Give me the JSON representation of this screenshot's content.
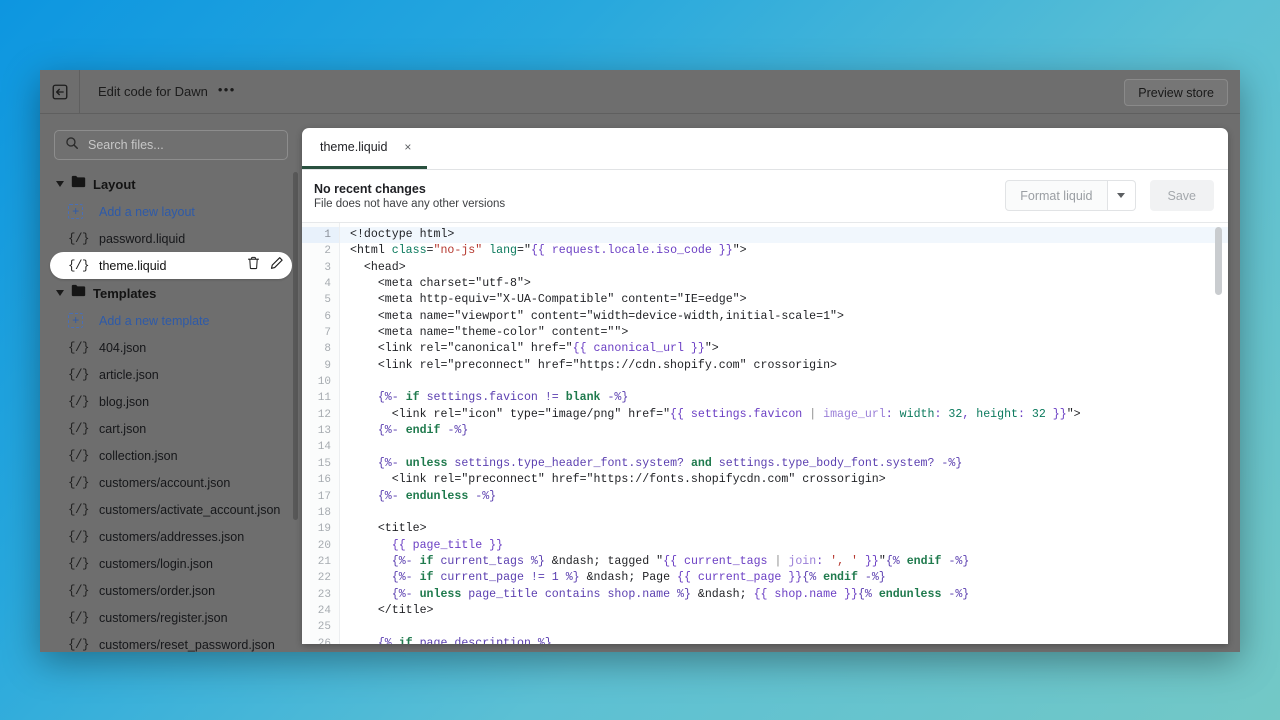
{
  "window": {
    "topbar": {
      "back_icon": "back-arrow-icon",
      "title": "Edit code for Dawn",
      "more_label": "•••",
      "preview_store_label": "Preview store"
    }
  },
  "sidebar": {
    "search": {
      "placeholder": "Search files...",
      "value": "",
      "icon": "search-icon"
    },
    "groups": [
      {
        "label": "Layout",
        "icon": "folder-icon",
        "items": [
          {
            "label": "Add a new layout",
            "icon": "add-file-icon",
            "kind": "add"
          },
          {
            "label": "password.liquid",
            "icon": "liquid-file-icon",
            "kind": "file"
          },
          {
            "label": "theme.liquid",
            "icon": "liquid-file-icon",
            "kind": "file",
            "selected": true,
            "actions": [
              "delete-icon",
              "rename-icon"
            ]
          }
        ]
      },
      {
        "label": "Templates",
        "icon": "folder-icon",
        "items": [
          {
            "label": "Add a new template",
            "icon": "add-file-icon",
            "kind": "add"
          },
          {
            "label": "404.json",
            "icon": "liquid-file-icon",
            "kind": "file"
          },
          {
            "label": "article.json",
            "icon": "liquid-file-icon",
            "kind": "file"
          },
          {
            "label": "blog.json",
            "icon": "liquid-file-icon",
            "kind": "file"
          },
          {
            "label": "cart.json",
            "icon": "liquid-file-icon",
            "kind": "file"
          },
          {
            "label": "collection.json",
            "icon": "liquid-file-icon",
            "kind": "file"
          },
          {
            "label": "customers/account.json",
            "icon": "liquid-file-icon",
            "kind": "file"
          },
          {
            "label": "customers/activate_account.json",
            "icon": "liquid-file-icon",
            "kind": "file"
          },
          {
            "label": "customers/addresses.json",
            "icon": "liquid-file-icon",
            "kind": "file"
          },
          {
            "label": "customers/login.json",
            "icon": "liquid-file-icon",
            "kind": "file"
          },
          {
            "label": "customers/order.json",
            "icon": "liquid-file-icon",
            "kind": "file"
          },
          {
            "label": "customers/register.json",
            "icon": "liquid-file-icon",
            "kind": "file"
          },
          {
            "label": "customers/reset_password.json",
            "icon": "liquid-file-icon",
            "kind": "file"
          }
        ]
      }
    ]
  },
  "editor": {
    "tabs": [
      {
        "label": "theme.liquid",
        "active": true,
        "close_label": "×"
      }
    ],
    "status": {
      "title": "No recent changes",
      "subtitle": "File does not have any other versions"
    },
    "actions": {
      "format_label": "Format liquid",
      "format_caret_icon": "chevron-down-icon",
      "save_label": "Save",
      "save_disabled": true
    },
    "filename": "theme.liquid",
    "first_visible_line": 1,
    "last_visible_line": 26,
    "highlighted_line": 1,
    "lines": [
      {
        "n": 1,
        "tokens": [
          [
            "plain",
            "<!doctype html>"
          ]
        ]
      },
      {
        "n": 2,
        "tokens": [
          [
            "plain",
            "<html "
          ],
          [
            "attr",
            "class"
          ],
          [
            "plain",
            "="
          ],
          [
            "str",
            "\"no-js\""
          ],
          [
            "plain",
            " "
          ],
          [
            "attr",
            "lang"
          ],
          [
            "plain",
            "=\""
          ],
          [
            "obj",
            "{{ request.locale.iso_code }}"
          ],
          [
            "plain",
            "\">"
          ]
        ]
      },
      {
        "n": 3,
        "tokens": [
          [
            "plain",
            "  <head>"
          ]
        ]
      },
      {
        "n": 4,
        "tokens": [
          [
            "plain",
            "    <meta charset=\"utf-8\">"
          ]
        ]
      },
      {
        "n": 5,
        "tokens": [
          [
            "plain",
            "    <meta http-equiv=\"X-UA-Compatible\" content=\"IE=edge\">"
          ]
        ]
      },
      {
        "n": 6,
        "tokens": [
          [
            "plain",
            "    <meta name=\"viewport\" content=\"width=device-width,initial-scale=1\">"
          ]
        ]
      },
      {
        "n": 7,
        "tokens": [
          [
            "plain",
            "    <meta name=\"theme-color\" content=\"\">"
          ]
        ]
      },
      {
        "n": 8,
        "tokens": [
          [
            "plain",
            "    <link rel=\"canonical\" href=\""
          ],
          [
            "obj",
            "{{ canonical_url }}"
          ],
          [
            "plain",
            "\">"
          ]
        ]
      },
      {
        "n": 9,
        "tokens": [
          [
            "plain",
            "    <link rel=\"preconnect\" href=\"https://cdn.shopify.com\" crossorigin>"
          ]
        ]
      },
      {
        "n": 10,
        "tokens": [
          [
            "plain",
            ""
          ]
        ]
      },
      {
        "n": 11,
        "tokens": [
          [
            "plain",
            "    "
          ],
          [
            "liq",
            "{%- "
          ],
          [
            "kw",
            "if"
          ],
          [
            "liq",
            " settings.favicon != "
          ],
          [
            "kw",
            "blank"
          ],
          [
            "liq",
            " -%}"
          ]
        ]
      },
      {
        "n": 12,
        "tokens": [
          [
            "plain",
            "      <link rel=\"icon\" type=\"image/png\" href=\""
          ],
          [
            "obj",
            "{{ settings.favicon "
          ],
          [
            "pipe",
            "| "
          ],
          [
            "fil",
            "image_url"
          ],
          [
            "obj",
            ": "
          ],
          [
            "num",
            "width"
          ],
          [
            "obj",
            ": "
          ],
          [
            "num",
            "32"
          ],
          [
            "obj",
            ", "
          ],
          [
            "num",
            "height"
          ],
          [
            "obj",
            ": "
          ],
          [
            "num",
            "32"
          ],
          [
            "obj",
            " }}"
          ],
          [
            "plain",
            "\">"
          ]
        ]
      },
      {
        "n": 13,
        "tokens": [
          [
            "plain",
            "    "
          ],
          [
            "liq",
            "{%- "
          ],
          [
            "kw",
            "endif"
          ],
          [
            "liq",
            " -%}"
          ]
        ]
      },
      {
        "n": 14,
        "tokens": [
          [
            "plain",
            ""
          ]
        ]
      },
      {
        "n": 15,
        "tokens": [
          [
            "plain",
            "    "
          ],
          [
            "liq",
            "{%- "
          ],
          [
            "kw",
            "unless"
          ],
          [
            "liq",
            " settings.type_header_font.system? "
          ],
          [
            "kw",
            "and"
          ],
          [
            "liq",
            " settings.type_body_font.system? -%}"
          ]
        ]
      },
      {
        "n": 16,
        "tokens": [
          [
            "plain",
            "      <link rel=\"preconnect\" href=\"https://fonts.shopifycdn.com\" crossorigin>"
          ]
        ]
      },
      {
        "n": 17,
        "tokens": [
          [
            "plain",
            "    "
          ],
          [
            "liq",
            "{%- "
          ],
          [
            "kw",
            "endunless"
          ],
          [
            "liq",
            " -%}"
          ]
        ]
      },
      {
        "n": 18,
        "tokens": [
          [
            "plain",
            ""
          ]
        ]
      },
      {
        "n": 19,
        "tokens": [
          [
            "plain",
            "    <title>"
          ]
        ]
      },
      {
        "n": 20,
        "tokens": [
          [
            "plain",
            "      "
          ],
          [
            "obj",
            "{{ page_title }}"
          ]
        ]
      },
      {
        "n": 21,
        "tokens": [
          [
            "plain",
            "      "
          ],
          [
            "liq",
            "{%- "
          ],
          [
            "kw",
            "if"
          ],
          [
            "liq",
            " current_tags %}"
          ],
          [
            "plain",
            " &ndash; tagged \""
          ],
          [
            "obj",
            "{{ current_tags "
          ],
          [
            "pipe",
            "| "
          ],
          [
            "fil",
            "join"
          ],
          [
            "obj",
            ": "
          ],
          [
            "str",
            "', '"
          ],
          [
            "obj",
            " }}"
          ],
          [
            "plain",
            "\""
          ],
          [
            "liq",
            "{% "
          ],
          [
            "kw",
            "endif"
          ],
          [
            "liq",
            " -%}"
          ]
        ]
      },
      {
        "n": 22,
        "tokens": [
          [
            "plain",
            "      "
          ],
          [
            "liq",
            "{%- "
          ],
          [
            "kw",
            "if"
          ],
          [
            "liq",
            " current_page != 1 %}"
          ],
          [
            "plain",
            " &ndash; Page "
          ],
          [
            "obj",
            "{{ current_page }}"
          ],
          [
            "liq",
            "{% "
          ],
          [
            "kw",
            "endif"
          ],
          [
            "liq",
            " -%}"
          ]
        ]
      },
      {
        "n": 23,
        "tokens": [
          [
            "plain",
            "      "
          ],
          [
            "liq",
            "{%- "
          ],
          [
            "kw",
            "unless"
          ],
          [
            "liq",
            " page_title contains shop.name %}"
          ],
          [
            "plain",
            " &ndash; "
          ],
          [
            "obj",
            "{{ shop.name }}"
          ],
          [
            "liq",
            "{% "
          ],
          [
            "kw",
            "endunless"
          ],
          [
            "liq",
            " -%}"
          ]
        ]
      },
      {
        "n": 24,
        "tokens": [
          [
            "plain",
            "    </title>"
          ]
        ]
      },
      {
        "n": 25,
        "tokens": [
          [
            "plain",
            ""
          ]
        ]
      },
      {
        "n": 26,
        "tokens": [
          [
            "plain",
            "    "
          ],
          [
            "liq",
            "{% "
          ],
          [
            "kw",
            "if"
          ],
          [
            "liq",
            " page_description %}"
          ]
        ]
      }
    ]
  },
  "colors": {
    "background_start": "#0d96e0",
    "background_end": "#73c8c6",
    "window_chrome": "#6e6e6e",
    "tab_accent": "#29513f",
    "link_blue": "#2e5aa8"
  }
}
